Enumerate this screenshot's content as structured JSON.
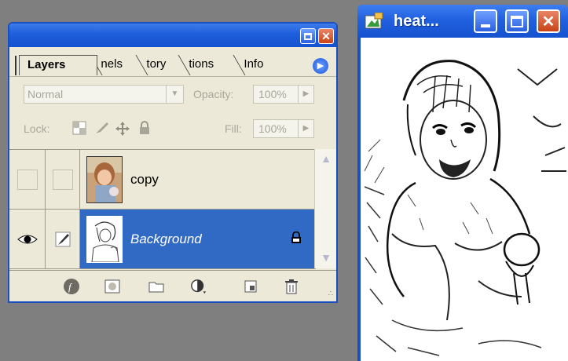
{
  "layers_palette": {
    "tabs": {
      "active": "Layers",
      "others": [
        "nels",
        "tory",
        "tions",
        "Info"
      ]
    },
    "blend_mode": "Normal",
    "opacity_label": "Opacity:",
    "opacity_value": "100%",
    "lock_label": "Lock:",
    "fill_label": "Fill:",
    "fill_value": "100%",
    "layers": [
      {
        "name": "copy",
        "visible": false,
        "selected": false
      },
      {
        "name": "Background",
        "visible": true,
        "selected": true,
        "locked": true
      }
    ]
  },
  "image_window": {
    "title": "heat..."
  },
  "colors": {
    "titlebar_blue": "#1f5edb",
    "selection_blue": "#316ac5",
    "panel_bg": "#ece9d8",
    "desktop_gray": "#7f7f7f"
  }
}
